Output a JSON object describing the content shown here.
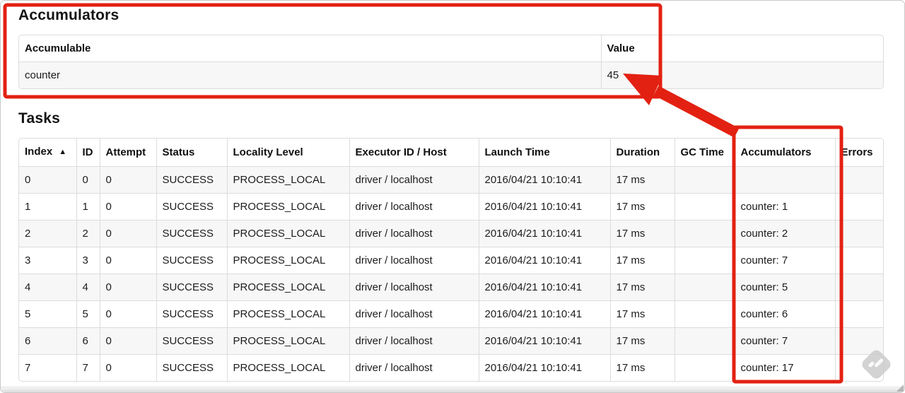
{
  "colors": {
    "annotation_red": "#e32112",
    "stripe_gray": "#f7f7f7",
    "table_border": "#dcdcdc",
    "watermark_gray": "#cccccc"
  },
  "accumulators": {
    "title": "Accumulators",
    "table": {
      "headers": [
        "Accumulable",
        "Value"
      ],
      "rows": [
        {
          "accumulable": "counter",
          "value": "45"
        }
      ]
    }
  },
  "tasks": {
    "title": "Tasks",
    "table": {
      "headers": [
        "Index",
        "ID",
        "Attempt",
        "Status",
        "Locality Level",
        "Executor ID / Host",
        "Launch Time",
        "Duration",
        "GC Time",
        "Accumulators",
        "Errors"
      ],
      "sort_icon": "▲",
      "rows": [
        {
          "index": "0",
          "id": "0",
          "attempt": "0",
          "status": "SUCCESS",
          "locality": "PROCESS_LOCAL",
          "executor": "driver / localhost",
          "launch": "2016/04/21 10:10:41",
          "duration": "17 ms",
          "gc": "",
          "accum": "",
          "errors": ""
        },
        {
          "index": "1",
          "id": "1",
          "attempt": "0",
          "status": "SUCCESS",
          "locality": "PROCESS_LOCAL",
          "executor": "driver / localhost",
          "launch": "2016/04/21 10:10:41",
          "duration": "17 ms",
          "gc": "",
          "accum": "counter: 1",
          "errors": ""
        },
        {
          "index": "2",
          "id": "2",
          "attempt": "0",
          "status": "SUCCESS",
          "locality": "PROCESS_LOCAL",
          "executor": "driver / localhost",
          "launch": "2016/04/21 10:10:41",
          "duration": "17 ms",
          "gc": "",
          "accum": "counter: 2",
          "errors": ""
        },
        {
          "index": "3",
          "id": "3",
          "attempt": "0",
          "status": "SUCCESS",
          "locality": "PROCESS_LOCAL",
          "executor": "driver / localhost",
          "launch": "2016/04/21 10:10:41",
          "duration": "17 ms",
          "gc": "",
          "accum": "counter: 7",
          "errors": ""
        },
        {
          "index": "4",
          "id": "4",
          "attempt": "0",
          "status": "SUCCESS",
          "locality": "PROCESS_LOCAL",
          "executor": "driver / localhost",
          "launch": "2016/04/21 10:10:41",
          "duration": "17 ms",
          "gc": "",
          "accum": "counter: 5",
          "errors": ""
        },
        {
          "index": "5",
          "id": "5",
          "attempt": "0",
          "status": "SUCCESS",
          "locality": "PROCESS_LOCAL",
          "executor": "driver / localhost",
          "launch": "2016/04/21 10:10:41",
          "duration": "17 ms",
          "gc": "",
          "accum": "counter: 6",
          "errors": ""
        },
        {
          "index": "6",
          "id": "6",
          "attempt": "0",
          "status": "SUCCESS",
          "locality": "PROCESS_LOCAL",
          "executor": "driver / localhost",
          "launch": "2016/04/21 10:10:41",
          "duration": "17 ms",
          "gc": "",
          "accum": "counter: 7",
          "errors": ""
        },
        {
          "index": "7",
          "id": "7",
          "attempt": "0",
          "status": "SUCCESS",
          "locality": "PROCESS_LOCAL",
          "executor": "driver / localhost",
          "launch": "2016/04/21 10:10:41",
          "duration": "17 ms",
          "gc": "",
          "accum": "counter: 17",
          "errors": ""
        }
      ]
    }
  },
  "annotations": {
    "box_1_target": "accumulators-section",
    "box_2_target": "tasks-accumulators-column",
    "arrow_target": "value-45"
  },
  "watermark_icon": "feedly-icon"
}
